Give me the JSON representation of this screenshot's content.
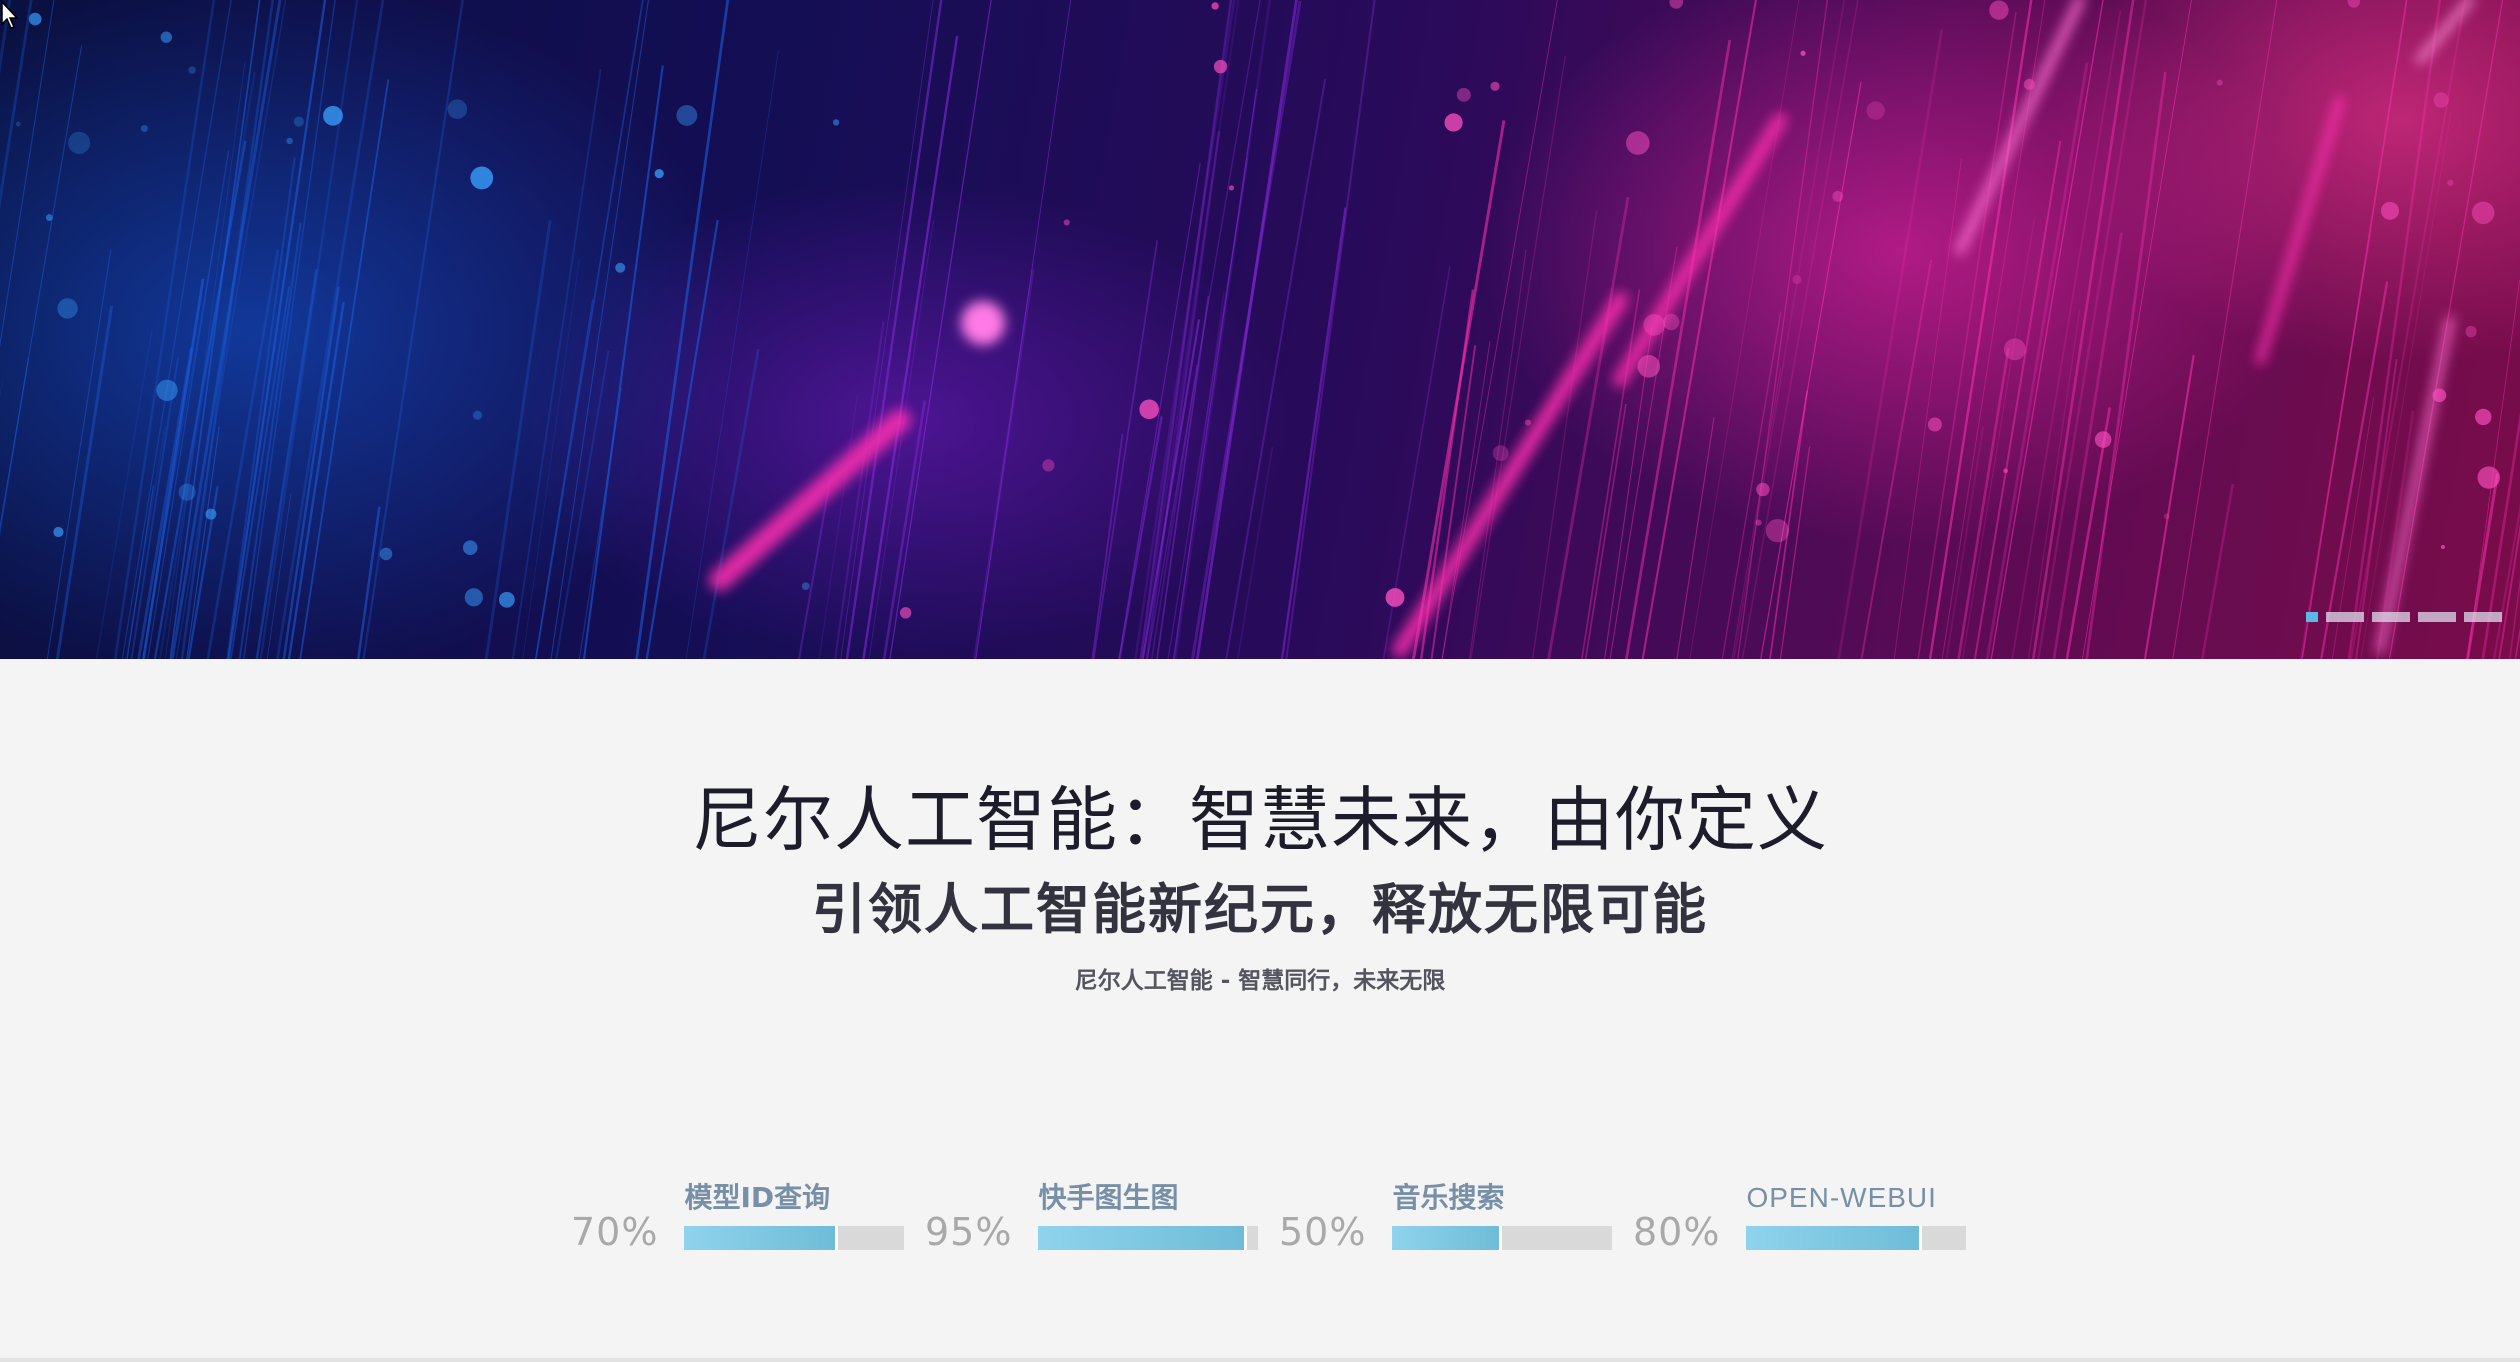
{
  "hero": {
    "slides": [
      {
        "active": true
      },
      {
        "active": false
      },
      {
        "active": false
      },
      {
        "active": false
      },
      {
        "active": false
      }
    ],
    "colors": {
      "blue": "#1c5fe0",
      "magenta": "#ff2fb0",
      "purple": "#8a2be2"
    }
  },
  "intro": {
    "title": "尼尔人工智能：智慧未来，由你定义",
    "subtitle": "引领人工智能新纪元，释放无限可能",
    "tagline": "尼尔人工智能 - 智慧同行，未来无限"
  },
  "skills": [
    {
      "percent_text": "70%",
      "label": "模型ID查询",
      "value": 0.7
    },
    {
      "percent_text": "95%",
      "label": "快手图生图",
      "value": 0.95
    },
    {
      "percent_text": "50%",
      "label": "音乐搜索",
      "value": 0.5
    },
    {
      "percent_text": "80%",
      "label": "OPEN-WEBUI",
      "value": 0.8
    }
  ],
  "colors": {
    "background": "#f4f4f4",
    "bar_fill": "#7cc6e0",
    "bar_track": "#d9d9d9",
    "label": "#7790a8",
    "percent": "#a9a9a9"
  }
}
